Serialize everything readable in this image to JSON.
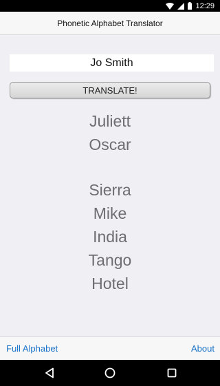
{
  "status_bar": {
    "time": "12:29",
    "icons": [
      "wifi-icon",
      "signal-icon",
      "battery-icon"
    ]
  },
  "header": {
    "title": "Phonetic Alphabet Translator"
  },
  "input": {
    "value": "Jo Smith"
  },
  "translate_button": {
    "label": "TRANSLATE!"
  },
  "results": {
    "first_name": [
      "Juliett",
      "Oscar"
    ],
    "last_name": [
      "Sierra",
      "Mike",
      "India",
      "Tango",
      "Hotel"
    ]
  },
  "footer": {
    "left_link": "Full Alphabet",
    "right_link": "About"
  },
  "android_nav": {
    "icons": [
      "back-icon",
      "home-icon",
      "recents-icon"
    ]
  },
  "colors": {
    "link": "#1a73c8",
    "result_text": "#6d6d72",
    "background": "#efeff4"
  }
}
